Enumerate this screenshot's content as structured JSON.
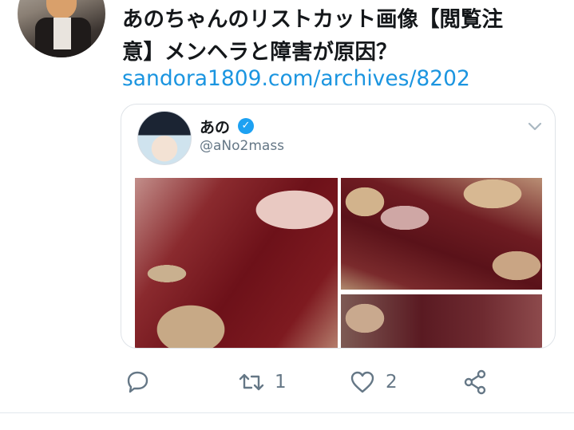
{
  "tweet": {
    "text_line1": "あのちゃんのリストカット画像【閲覧注",
    "text_line2": "意】メンヘラと障害が原因？",
    "link": "sandora1809.com/archives/8202"
  },
  "quoted_tweet": {
    "name": "あの",
    "verified": true,
    "handle": "@aNo2mass"
  },
  "actions": {
    "reply_icon": "reply-icon",
    "retweet_icon": "retweet-icon",
    "retweet_count": "1",
    "like_icon": "heart-icon",
    "like_count": "2",
    "share_icon": "share-icon"
  },
  "colors": {
    "link": "#1b95e0",
    "muted": "#657786",
    "verified": "#1da1f2"
  }
}
